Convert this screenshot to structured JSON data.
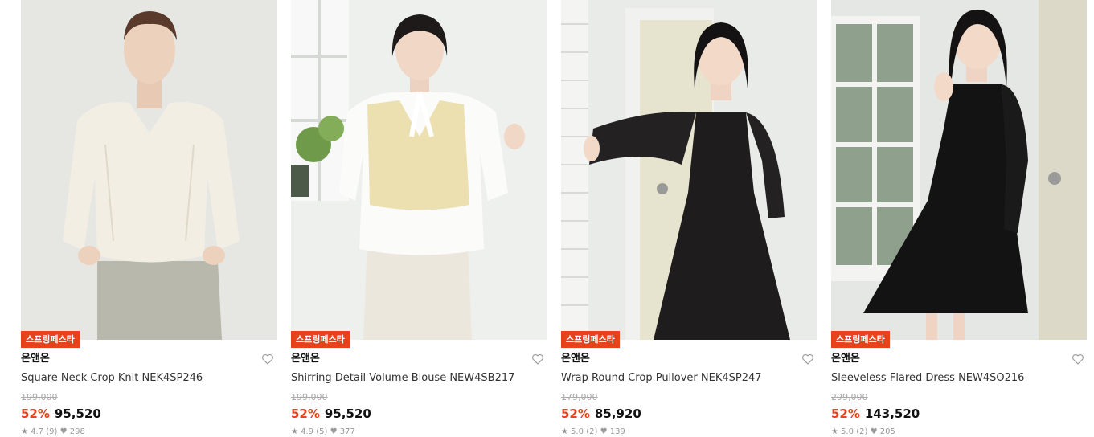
{
  "products": [
    {
      "badge": "스프링페스타",
      "brand": "온앤온",
      "name": "Square Neck Crop Knit NEK4SP246",
      "original_price": "199,000",
      "discount": "52%",
      "price": "95,520",
      "rating": "★ 4.7 (9)",
      "likes": "♥ 298",
      "bg_color": "#e6e6e3",
      "garment_color": "#f2eee4"
    },
    {
      "badge": "스프링페스타",
      "brand": "온앤온",
      "name": "Shirring Detail Volume Blouse NEW4SB217",
      "original_price": "199,000",
      "discount": "52%",
      "price": "95,520",
      "rating": "★ 4.9 (5)",
      "likes": "♥ 377",
      "bg_color": "#eef0ee",
      "garment_color": "#ece0b0"
    },
    {
      "badge": "스프링페스타",
      "brand": "온앤온",
      "name": "Wrap Round Crop Pullover NEK4SP247",
      "original_price": "179,000",
      "discount": "52%",
      "price": "85,920",
      "rating": "★ 5.0 (2)",
      "likes": "♥ 139",
      "bg_color": "#e9ebe8",
      "garment_color": "#1e1c1d"
    },
    {
      "badge": "스프링페스타",
      "brand": "온앤온",
      "name": "Sleeveless Flared Dress NEW4SO216",
      "original_price": "299,000",
      "discount": "52%",
      "price": "143,520",
      "rating": "★ 5.0 (2)",
      "likes": "♥ 205",
      "bg_color": "#e4e7e4",
      "garment_color": "#141314"
    }
  ],
  "colors": {
    "accent": "#e8411d",
    "strike": "#aaaaaa"
  }
}
